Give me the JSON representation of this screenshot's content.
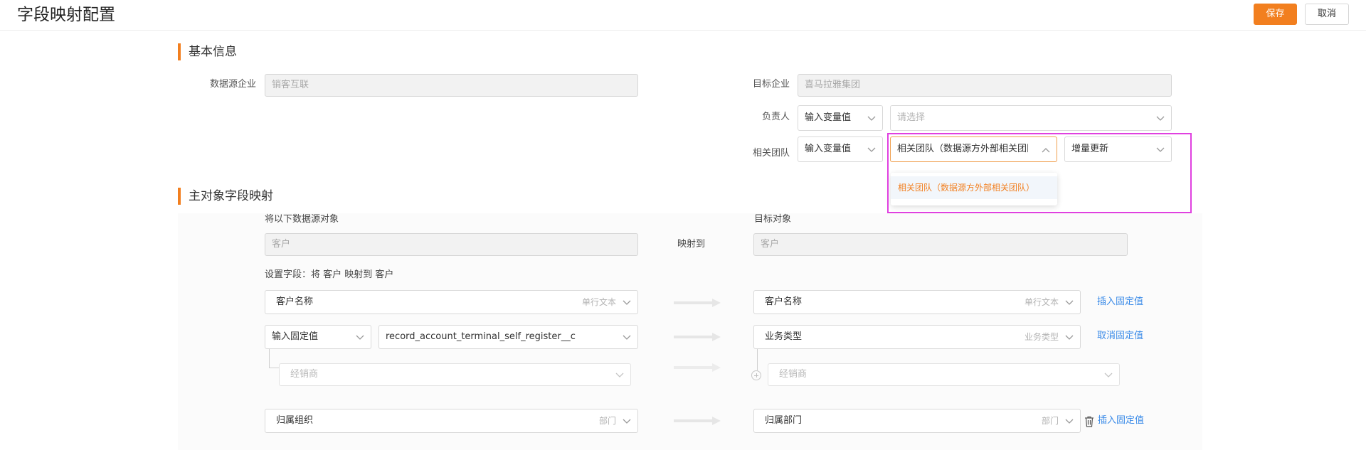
{
  "header": {
    "title": "字段映射配置",
    "save_label": "保存",
    "cancel_label": "取消"
  },
  "basic": {
    "section_title": "基本信息",
    "source_label": "数据源企业",
    "source_value": "销客互联",
    "target_label": "目标企业",
    "target_value": "喜马拉雅集团",
    "owner_label": "负责人",
    "owner_mode": "输入变量值",
    "owner_placeholder": "请选择",
    "team_label": "相关团队",
    "team_mode": "输入变量值",
    "team_value": "相关团队（数据源方外部相关团队）",
    "team_update": "增量更新",
    "team_dropdown_option": "相关团队（数据源方外部相关团队）"
  },
  "mapping": {
    "section_title": "主对象字段映射",
    "source_object_label": "将以下数据源对象",
    "source_object_value": "客户",
    "map_to_label": "映射到",
    "target_object_label": "目标对象",
    "target_object_value": "客户",
    "fields_caption": "设置字段：将 客户 映射到 客户",
    "rows": [
      {
        "source_name": "客户名称",
        "source_type": "单行文本",
        "target_name": "客户名称",
        "target_type": "单行文本",
        "action": "插入固定值"
      },
      {
        "source_mode": "输入固定值",
        "source_value": "record_account_terminal_self_register__c",
        "target_name": "业务类型",
        "target_type": "业务类型",
        "action": "取消固定值"
      },
      {
        "source_name": "经销商",
        "target_name": "经销商"
      },
      {
        "source_name": "归属组织",
        "source_type": "部门",
        "target_name": "归属部门",
        "target_type": "部门",
        "action": "插入固定值"
      }
    ]
  },
  "colors": {
    "accent": "#f27f1f",
    "link": "#3b8be8",
    "highlight": "#e040e0"
  }
}
